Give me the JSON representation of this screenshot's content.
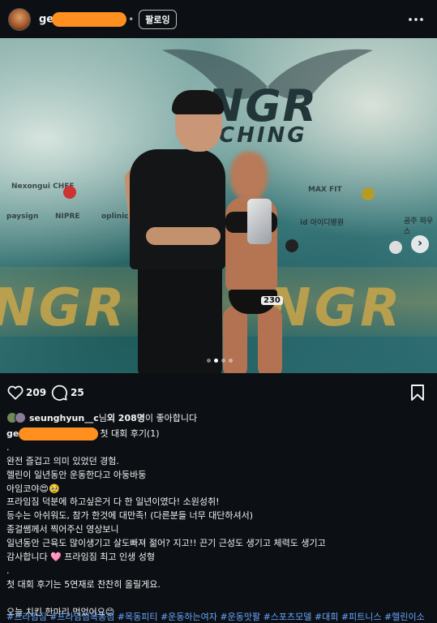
{
  "header": {
    "username_visible": "ge",
    "separator": "•",
    "follow_label": "팔로잉"
  },
  "post": {
    "banner_logo": "NGR",
    "banner_sub": "CHING",
    "bib_number": "230",
    "sponsors": [
      "Nexongui CHEF",
      "paysign",
      "NIPRE",
      "oplinic",
      "id 아이디병원",
      "MAX FIT",
      "공주 하우스"
    ],
    "carousel": {
      "count": 4,
      "active_index": 1
    }
  },
  "actions": {
    "like_count": "209",
    "comment_count": "25"
  },
  "liked_by": {
    "user": "seunghyun__c",
    "suffix_pre": "님 ",
    "others": "외 208명",
    "suffix_post": "이 좋아합니다"
  },
  "caption": {
    "user_visible": "ge",
    "title": "첫 대회 후기(1)",
    "lines": [
      ".",
      "완전 즐겁고 의미 있었던 경험.",
      "헬린이 일년동안 운동한다고 아둥바둥",
      "아임코야😍🥹",
      "프라임짐 덕분에 하고싶은거 다 한 일년이였다! 소원성취!",
      "등수는 아쉬워도, 참가 한것에 대만족! (다른분들 너무 대단하셔서)",
      "종걸쌤께서 찍어주신 영상보니",
      "일년동안 근육도 많이생기고 살도빠져 젊어? 지고!! 끈기 근성도 생기고 체력도 생기고",
      "감사합니다 🩷 프라임짐 최고 인생 성형",
      ".",
      "첫 대회 후기는 5연재로 찬찬히 올릴게요.",
      "",
      "오늘 치킨 한마리 먹었어요😊",
      "."
    ],
    "hashtags": "#프라임짐 #프라임짐목동점 #목동피티 #운동하는여자 #운동맛팔 #스포츠모델 #대회 #피트니스 #헬린이소"
  },
  "colors": {
    "background": "#0c1014",
    "redaction": "#ff8f1f",
    "hashtag": "#6aa6ff"
  },
  "icons": [
    "more-icon",
    "heart-icon",
    "comment-icon",
    "bookmark-icon",
    "chevron-right-icon"
  ]
}
